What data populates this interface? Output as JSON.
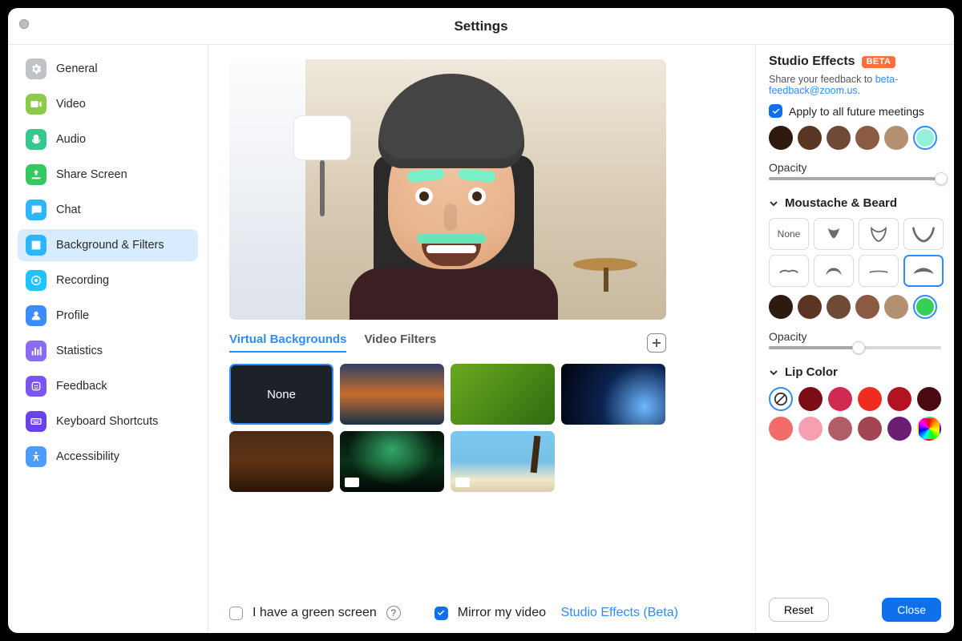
{
  "window": {
    "title": "Settings"
  },
  "sidebar": {
    "items": [
      {
        "id": "general",
        "label": "General",
        "bg": "#BFC2C7"
      },
      {
        "id": "video",
        "label": "Video",
        "bg": "#8CCB4A"
      },
      {
        "id": "audio",
        "label": "Audio",
        "bg": "#36C98F"
      },
      {
        "id": "share",
        "label": "Share Screen",
        "bg": "#35C85F"
      },
      {
        "id": "chat",
        "label": "Chat",
        "bg": "#2DB6FF"
      },
      {
        "id": "bgfilters",
        "label": "Background & Filters",
        "bg": "#2DB6FF",
        "selected": true
      },
      {
        "id": "recording",
        "label": "Recording",
        "bg": "#1FC3FF"
      },
      {
        "id": "profile",
        "label": "Profile",
        "bg": "#3A8CFF"
      },
      {
        "id": "stats",
        "label": "Statistics",
        "bg": "#8A6CF4"
      },
      {
        "id": "feedback",
        "label": "Feedback",
        "bg": "#7A55F2"
      },
      {
        "id": "shortcuts",
        "label": "Keyboard Shortcuts",
        "bg": "#6A43E8"
      },
      {
        "id": "a11y",
        "label": "Accessibility",
        "bg": "#4D9CFF"
      }
    ]
  },
  "tabs": {
    "virtual": "Virtual Backgrounds",
    "filters": "Video Filters",
    "active": "virtual"
  },
  "backgrounds": {
    "none_label": "None",
    "items": [
      "none",
      "bridge",
      "grass",
      "earth",
      "hall",
      "aurora",
      "beach"
    ]
  },
  "controls": {
    "green_screen": "I have a green screen",
    "mirror": "Mirror my video",
    "studio_link": "Studio Effects (Beta)"
  },
  "studio": {
    "title": "Studio Effects",
    "badge": "BETA",
    "feedback_prefix": "Share your feedback to ",
    "feedback_link": "beta-feedback@zoom.us",
    "feedback_suffix": ".",
    "apply_all": "Apply to all future meetings",
    "eyebrow_colors": [
      "#2E1A0E",
      "#5A3524",
      "#6E4A37",
      "#8A5B42",
      "#B49073",
      "#93F0DA"
    ],
    "eyebrow_selected": 5,
    "opacity_label": "Opacity",
    "eyebrow_opacity": 100,
    "section_beard": "Moustache & Beard",
    "beard_none": "None",
    "beard_options": [
      "none",
      "soulpatch",
      "goatee",
      "chinstrap",
      "thin-stache",
      "handlebar",
      "pencil",
      "thick-stache"
    ],
    "beard_selected": 7,
    "beard_colors": [
      "#2E1A0E",
      "#5A3524",
      "#6E4A37",
      "#8A5B42",
      "#B49073",
      "#34D058"
    ],
    "beard_color_selected": 5,
    "beard_opacity": 52,
    "section_lip": "Lip Color",
    "lip_colors": [
      "none",
      "#7A0E14",
      "#D12A52",
      "#F02C1F",
      "#B31221",
      "#4A0A12",
      "#F26D6A",
      "#F59FB1",
      "#B25E68",
      "#A34452",
      "#6A1F74",
      "rainbow"
    ],
    "lip_selected": 0,
    "reset": "Reset",
    "close": "Close"
  }
}
